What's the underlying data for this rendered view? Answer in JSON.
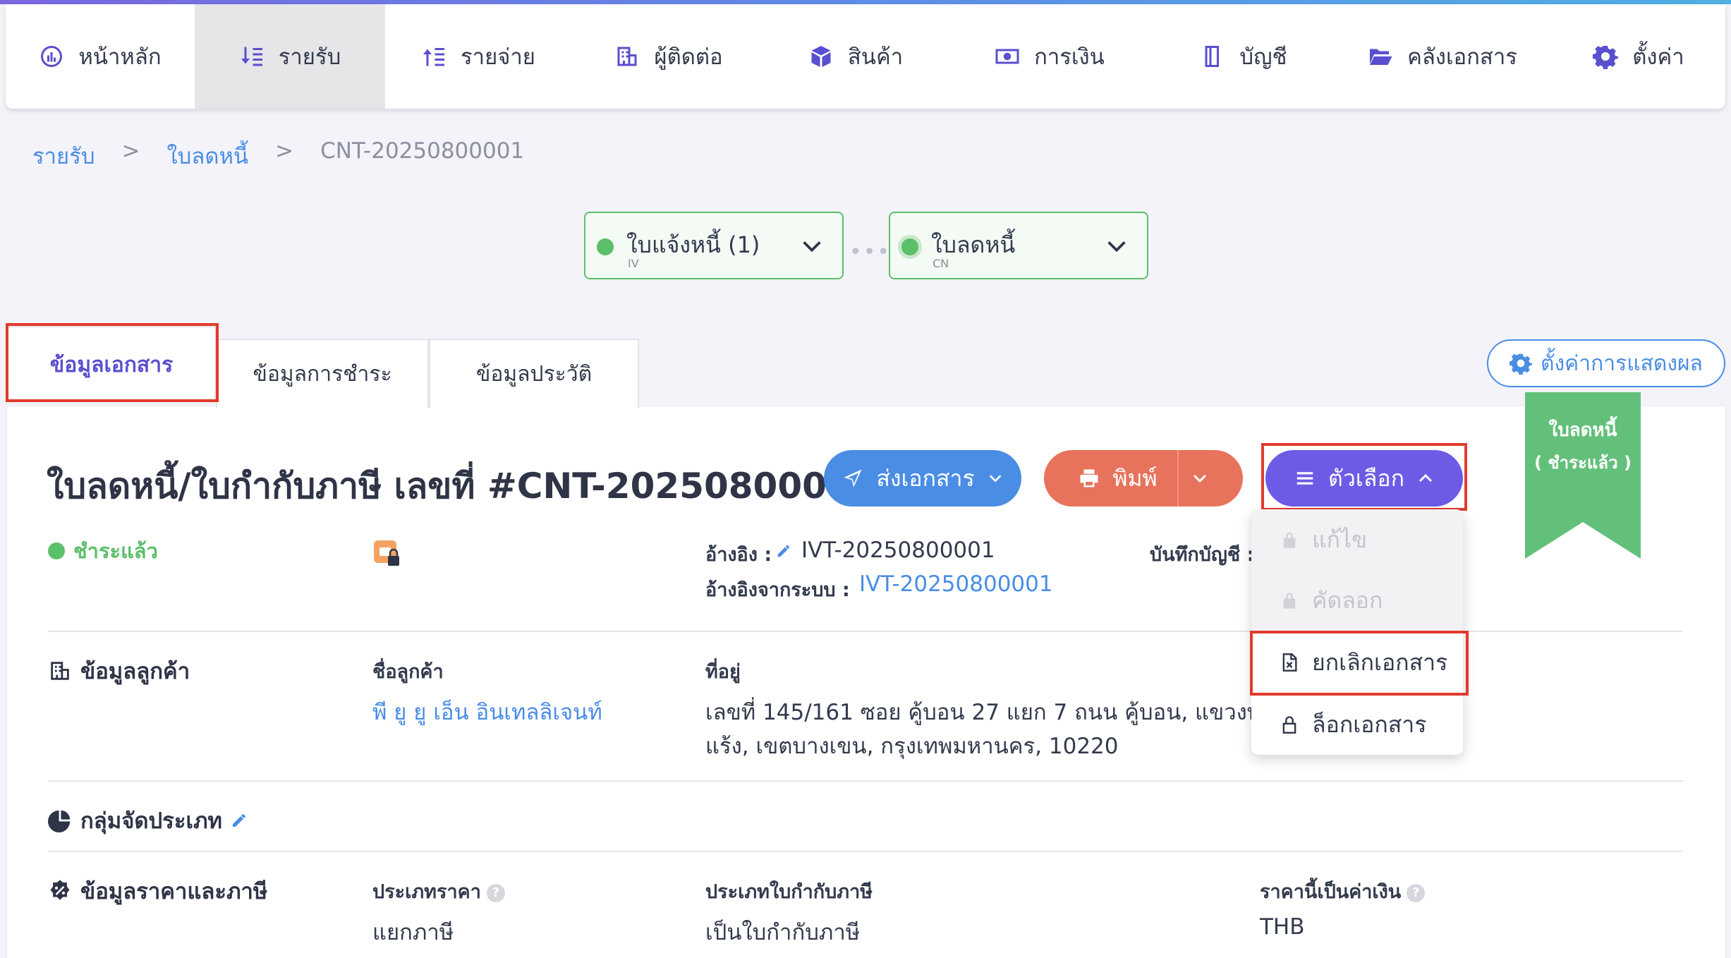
{
  "nav": {
    "items": [
      {
        "label": "หน้าหลัก",
        "icon": "dashboard-icon"
      },
      {
        "label": "รายรับ",
        "icon": "income-icon"
      },
      {
        "label": "รายจ่าย",
        "icon": "expense-icon"
      },
      {
        "label": "ผู้ติดต่อ",
        "icon": "contacts-icon"
      },
      {
        "label": "สินค้า",
        "icon": "box-icon"
      },
      {
        "label": "การเงิน",
        "icon": "money-icon"
      },
      {
        "label": "บัญชี",
        "icon": "ledger-icon"
      },
      {
        "label": "คลังเอกสาร",
        "icon": "folder-icon"
      },
      {
        "label": "ตั้งค่า",
        "icon": "gear-icon"
      }
    ],
    "active_index": 1
  },
  "breadcrumb": {
    "level1": "รายรับ",
    "level2": "ใบลดหนี้",
    "separator": ">",
    "current": "CNT-20250800001"
  },
  "flow": {
    "step1": {
      "title": "ใบแจ้งหนี้ (1)",
      "sub": "IV"
    },
    "step2": {
      "title": "ใบลดหนี้",
      "sub": "CN"
    }
  },
  "tabs": {
    "doc_info": "ข้อมูลเอกสาร",
    "payment_info": "ข้อมูลการชำระ",
    "history_info": "ข้อมูลประวัติ"
  },
  "display_settings_label": "ตั้งค่าการแสดงผล",
  "ribbon": {
    "line1": "ใบลดหนี้",
    "line2": "( ชำระแล้ว )"
  },
  "document": {
    "title": "ใบลดหนี้/ใบกำกับภาษี เลขที่ #CNT-20250800001",
    "status": "ชำระแล้ว",
    "reference_label": "อ้างอิง :",
    "reference_value": "IVT-20250800001",
    "system_reference_label": "อ้างอิงจากระบบ :",
    "system_reference_value": "IVT-20250800001",
    "journal_label": "บันทึกบัญชี :"
  },
  "actions": {
    "send": "ส่งเอกสาร",
    "print": "พิมพ์",
    "options": "ตัวเลือก"
  },
  "options_menu": {
    "edit": "แก้ไข",
    "copy": "คัดลอก",
    "cancel": "ยกเลิกเอกสาร",
    "lock": "ล็อกเอกสาร"
  },
  "customer": {
    "section_title": "ข้อมูลลูกค้า",
    "name_label": "ชื่อลูกค้า",
    "name_value": "พี ยู ยู เอ็น อินเทลลิเจนท์",
    "address_label": "ที่อยู่",
    "address_line1": "เลขที่ 145/161 ซอย คู้บอน 27 แยก 7 ถนน คู้บอน, แขวงท่า",
    "address_line2": "แร้ง, เขตบางเขน, กรุงเทพมหานคร, 10220"
  },
  "category": {
    "section_title": "กลุ่มจัดประเภท"
  },
  "pricing": {
    "section_title": "ข้อมูลราคาและภาษี",
    "price_type_label": "ประเภทราคา",
    "price_type_value": "แยกภาษี",
    "tax_invoice_type_label": "ประเภทใบกำกับภาษี",
    "tax_invoice_type_value": "เป็นใบกำกับภาษี",
    "currency_label": "ราคานี้เป็นค่าเงิน",
    "currency_value": "THB"
  },
  "colors": {
    "brand": "#5a4fcf",
    "link": "#4a8de5",
    "success": "#5cbf6a",
    "print": "#e8735c",
    "highlight": "#e23b2e"
  }
}
